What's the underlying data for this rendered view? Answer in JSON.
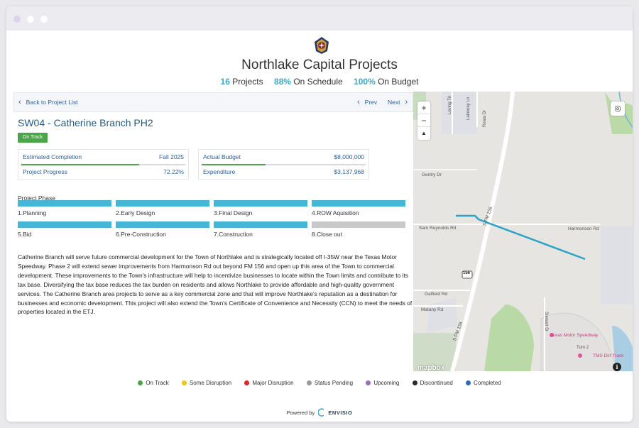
{
  "header": {
    "title": "Northlake Capital Projects",
    "stats": [
      {
        "value": "16",
        "label": "Projects"
      },
      {
        "value": "88%",
        "label": "On Schedule"
      },
      {
        "value": "100%",
        "label": "On Budget"
      }
    ]
  },
  "nav": {
    "back_label": "Back to Project List",
    "prev_label": "Prev",
    "next_label": "Next"
  },
  "project": {
    "title": "SW04 - Catherine Branch PH2",
    "status": "On Track",
    "status_color": "#4aa648",
    "estimated_completion_label": "Estimated Completion",
    "estimated_completion_value": "Fall 2025",
    "schedule_progress_fraction": 0.72,
    "progress_label": "Project Progress",
    "progress_value": "72.22%",
    "budget_label": "Actual Budget",
    "budget_value": "$8,000,000",
    "budget_fill_fraction": 0.39,
    "expenditure_label": "Expenditure",
    "expenditure_value": "$3,137,968"
  },
  "phase": {
    "label": "Project Phase",
    "items": [
      {
        "label": "1.Planning",
        "complete": true
      },
      {
        "label": "2.Early Design",
        "complete": true
      },
      {
        "label": "3.Final Design",
        "complete": true
      },
      {
        "label": "4.ROW Aquisition",
        "complete": true
      },
      {
        "label": "5.Bid",
        "complete": true
      },
      {
        "label": "6.Pre-Construction",
        "complete": true
      },
      {
        "label": "7.Construction",
        "complete": true
      },
      {
        "label": "8.Close out",
        "complete": false
      }
    ],
    "complete_color": "#46b6d6",
    "incomplete_color": "#c9c9c9"
  },
  "description": "Catherine Branch will serve future commercial development for the Town of Northlake and is strategically located off I-35W near the Texas Motor Speedway. Phase 2 will extend sewer improvements from Harmonson Rd out beyond FM 156 and open up this area of the Town to commercial development. These improvements to the Town's infrastructure will help to incentivize businesses to locate within the Town limits and contribute to its tax base. Diversifying the tax base reduces the tax burden on residents and allows Northlake to provide affordable and high-quality government services. The Catherine Branch area projects to serve as a key commercial zone and that will improve Northlake's reputation as a destination for businesses and economic development. This project will also extend the Town's Certificate of Convenience and Necessity (CCN) to meet the needs of properties located in the ETJ.",
  "map": {
    "zoom_in": "+",
    "zoom_out": "−",
    "compass": "▲",
    "labels": {
      "loving_trl": "Loving Trl",
      "lakeway_ln": "Lakeway Ln",
      "reata_dr": "Reata Dr",
      "gentry_dr": "Gentry Dr",
      "sam_reynolds_rd": "Sam Reynolds Rd",
      "s_fm_156_top": "S FM 156",
      "harmonson_rd": "Harmonson Rd",
      "shield": "156",
      "galfield_rd": "Galfield Rd",
      "matany_rd": "Matany Rd",
      "s_fm_156_bottom": "S FM 156",
      "stewart_st": "Stewart St",
      "texas_motor_speedway": "Texas Motor Speedway",
      "turn_2": "Turn 2",
      "tms_dirt_track": "TMS Dirt Track"
    },
    "attribution_logo": "mapbox",
    "info": "i",
    "project_line_color": "#2aa3c6"
  },
  "legend": [
    {
      "label": "On Track",
      "color": "#4aa648"
    },
    {
      "label": "Some Disruption",
      "color": "#f4c21b"
    },
    {
      "label": "Major Disruption",
      "color": "#d9262b"
    },
    {
      "label": "Status Pending",
      "color": "#9a9a9a"
    },
    {
      "label": "Upcoming",
      "color": "#9b6fbf"
    },
    {
      "label": "Discontinued",
      "color": "#2b2b2b"
    },
    {
      "label": "Completed",
      "color": "#2f6bb5"
    }
  ],
  "footer": {
    "powered_by": "Powered by",
    "brand": "ENVISIO"
  }
}
